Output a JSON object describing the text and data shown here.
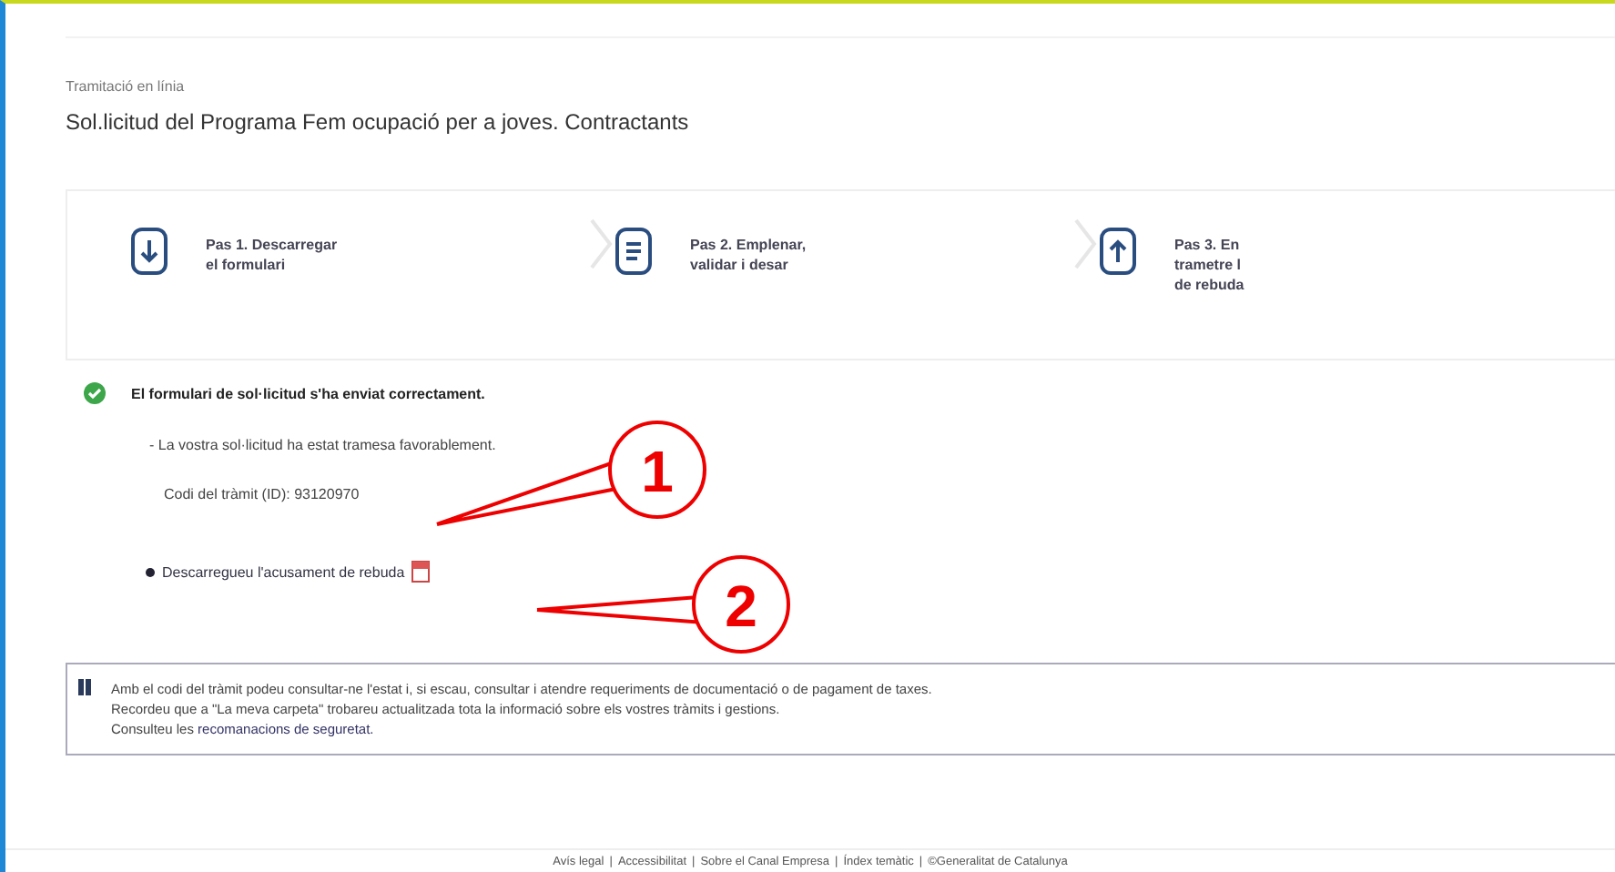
{
  "breadcrumb": "Tramitació en línia",
  "title": "Sol.licitud del Programa Fem ocupació per a joves. Contractants",
  "steps": [
    {
      "kind": "download",
      "lines": [
        "Pas 1. Descarregar",
        "el formulari"
      ]
    },
    {
      "kind": "document",
      "lines": [
        "Pas 2. Emplenar,",
        "validar i desar"
      ]
    },
    {
      "kind": "upload",
      "lines": [
        "Pas 3. En",
        "trametre l",
        "de rebuda"
      ]
    }
  ],
  "result": {
    "message": "El formulari de sol·licitud s'ha enviat correctament.",
    "detail": "- La vostra sol·licitud ha estat tramesa favorablement.",
    "code": "Codi del tràmit (ID): 93120970",
    "download_link": "Descarregueu l'acusament de rebuda"
  },
  "info": {
    "lines": [
      "Amb el codi del tràmit podeu consultar-ne l'estat i, si escau, consultar i atendre requeriments de documentació o de pagament de taxes.",
      "Recordeu que a \"La meva carpeta\" trobareu actualitzada tota la informació sobre els vostres tràmits i gestions."
    ],
    "link_prefix": "Consulteu les",
    "link": "recomanacions de seguretat."
  },
  "footer_separator": "|",
  "footer": [
    "Avís legal",
    "Accessibilitat",
    "Sobre el Canal Empresa",
    "Índex temàtic",
    "©Generalitat de Catalunya"
  ],
  "callouts": [
    {
      "label": "1"
    },
    {
      "label": "2"
    }
  ]
}
